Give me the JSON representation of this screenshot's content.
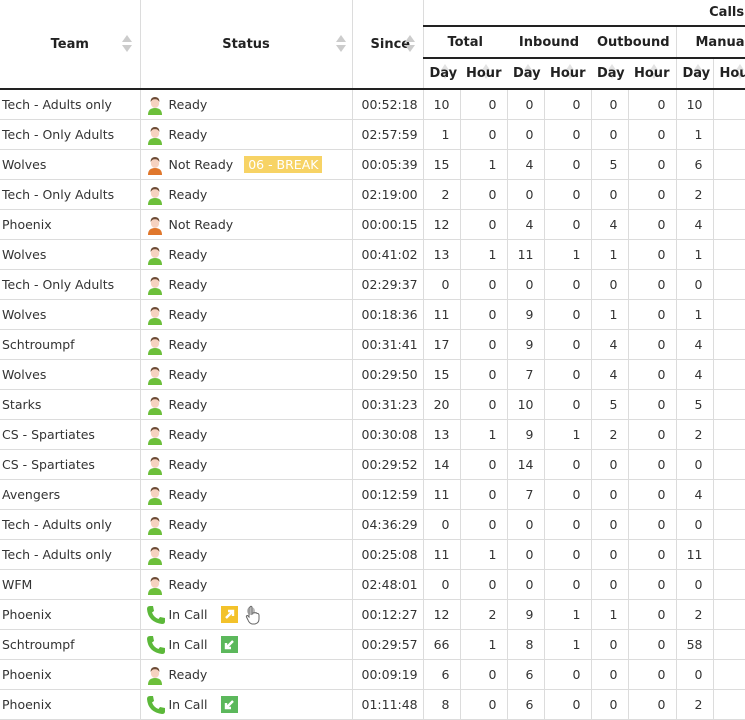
{
  "header": {
    "team": "Team",
    "status": "Status",
    "since": "Since",
    "calls": "Calls",
    "groups": [
      "Total",
      "Inbound",
      "Outbound",
      "Manual"
    ],
    "day": "Day",
    "hour": "Hour",
    "hour_truncated": "Hou"
  },
  "colors": {
    "ready_icon": "#6cbf3a",
    "not_ready_icon": "#e0772c",
    "in_call_icon": "#5cb83a",
    "break_badge": "#f7d365",
    "outbound_badge": "#f3c22b",
    "inbound_badge": "#5cb85c"
  },
  "rows": [
    {
      "team": "Tech - Adults only",
      "status": "Ready",
      "icon": "user-ready",
      "since": "00:52:18",
      "total_day": "10",
      "total_hour": "0",
      "in_day": "0",
      "in_hour": "0",
      "out_day": "0",
      "out_hour": "0",
      "man_day": "10"
    },
    {
      "team": "Tech - Only Adults",
      "status": "Ready",
      "icon": "user-ready",
      "since": "02:57:59",
      "total_day": "1",
      "total_hour": "0",
      "in_day": "0",
      "in_hour": "0",
      "out_day": "0",
      "out_hour": "0",
      "man_day": "1"
    },
    {
      "team": "Wolves",
      "status": "Not Ready",
      "icon": "user-not-ready",
      "badge": "06 - BREAK",
      "since": "00:05:39",
      "total_day": "15",
      "total_hour": "1",
      "in_day": "4",
      "in_hour": "0",
      "out_day": "5",
      "out_hour": "0",
      "man_day": "6"
    },
    {
      "team": "Tech - Only Adults",
      "status": "Ready",
      "icon": "user-ready",
      "since": "02:19:00",
      "total_day": "2",
      "total_hour": "0",
      "in_day": "0",
      "in_hour": "0",
      "out_day": "0",
      "out_hour": "0",
      "man_day": "2"
    },
    {
      "team": "Phoenix",
      "status": "Not Ready",
      "icon": "user-not-ready",
      "since": "00:00:15",
      "total_day": "12",
      "total_hour": "0",
      "in_day": "4",
      "in_hour": "0",
      "out_day": "4",
      "out_hour": "0",
      "man_day": "4"
    },
    {
      "team": "Wolves",
      "status": "Ready",
      "icon": "user-ready",
      "since": "00:41:02",
      "total_day": "13",
      "total_hour": "1",
      "in_day": "11",
      "in_hour": "1",
      "out_day": "1",
      "out_hour": "0",
      "man_day": "1"
    },
    {
      "team": "Tech - Only Adults",
      "status": "Ready",
      "icon": "user-ready",
      "since": "02:29:37",
      "total_day": "0",
      "total_hour": "0",
      "in_day": "0",
      "in_hour": "0",
      "out_day": "0",
      "out_hour": "0",
      "man_day": "0"
    },
    {
      "team": "Wolves",
      "status": "Ready",
      "icon": "user-ready",
      "since": "00:18:36",
      "total_day": "11",
      "total_hour": "0",
      "in_day": "9",
      "in_hour": "0",
      "out_day": "1",
      "out_hour": "0",
      "man_day": "1"
    },
    {
      "team": "Schtroumpf",
      "status": "Ready",
      "icon": "user-ready",
      "since": "00:31:41",
      "total_day": "17",
      "total_hour": "0",
      "in_day": "9",
      "in_hour": "0",
      "out_day": "4",
      "out_hour": "0",
      "man_day": "4"
    },
    {
      "team": "Wolves",
      "status": "Ready",
      "icon": "user-ready",
      "since": "00:29:50",
      "total_day": "15",
      "total_hour": "0",
      "in_day": "7",
      "in_hour": "0",
      "out_day": "4",
      "out_hour": "0",
      "man_day": "4"
    },
    {
      "team": "Starks",
      "status": "Ready",
      "icon": "user-ready",
      "since": "00:31:23",
      "total_day": "20",
      "total_hour": "0",
      "in_day": "10",
      "in_hour": "0",
      "out_day": "5",
      "out_hour": "0",
      "man_day": "5"
    },
    {
      "team": "CS - Spartiates",
      "status": "Ready",
      "icon": "user-ready",
      "since": "00:30:08",
      "total_day": "13",
      "total_hour": "1",
      "in_day": "9",
      "in_hour": "1",
      "out_day": "2",
      "out_hour": "0",
      "man_day": "2"
    },
    {
      "team": "CS - Spartiates",
      "status": "Ready",
      "icon": "user-ready",
      "since": "00:29:52",
      "total_day": "14",
      "total_hour": "0",
      "in_day": "14",
      "in_hour": "0",
      "out_day": "0",
      "out_hour": "0",
      "man_day": "0"
    },
    {
      "team": "Avengers",
      "status": "Ready",
      "icon": "user-ready",
      "since": "00:12:59",
      "total_day": "11",
      "total_hour": "0",
      "in_day": "7",
      "in_hour": "0",
      "out_day": "0",
      "out_hour": "0",
      "man_day": "4"
    },
    {
      "team": "Tech - Adults only",
      "status": "Ready",
      "icon": "user-ready",
      "since": "04:36:29",
      "total_day": "0",
      "total_hour": "0",
      "in_day": "0",
      "in_hour": "0",
      "out_day": "0",
      "out_hour": "0",
      "man_day": "0"
    },
    {
      "team": "Tech - Adults only",
      "status": "Ready",
      "icon": "user-ready",
      "since": "00:25:08",
      "total_day": "11",
      "total_hour": "1",
      "in_day": "0",
      "in_hour": "0",
      "out_day": "0",
      "out_hour": "0",
      "man_day": "11"
    },
    {
      "team": "WFM",
      "status": "Ready",
      "icon": "user-ready",
      "since": "02:48:01",
      "total_day": "0",
      "total_hour": "0",
      "in_day": "0",
      "in_hour": "0",
      "out_day": "0",
      "out_hour": "0",
      "man_day": "0"
    },
    {
      "team": "Phoenix",
      "status": "In Call",
      "icon": "phone",
      "direction": "outbound",
      "hand": true,
      "since": "00:12:27",
      "total_day": "12",
      "total_hour": "2",
      "in_day": "9",
      "in_hour": "1",
      "out_day": "1",
      "out_hour": "0",
      "man_day": "2"
    },
    {
      "team": "Schtroumpf",
      "status": "In Call",
      "icon": "phone",
      "direction": "inbound",
      "since": "00:29:57",
      "total_day": "66",
      "total_hour": "1",
      "in_day": "8",
      "in_hour": "1",
      "out_day": "0",
      "out_hour": "0",
      "man_day": "58"
    },
    {
      "team": "Phoenix",
      "status": "Ready",
      "icon": "user-ready",
      "since": "00:09:19",
      "total_day": "6",
      "total_hour": "0",
      "in_day": "6",
      "in_hour": "0",
      "out_day": "0",
      "out_hour": "0",
      "man_day": "0"
    },
    {
      "team": "Phoenix",
      "status": "In Call",
      "icon": "phone",
      "direction": "inbound",
      "since": "01:11:48",
      "total_day": "8",
      "total_hour": "0",
      "in_day": "6",
      "in_hour": "0",
      "out_day": "0",
      "out_hour": "0",
      "man_day": "2"
    }
  ]
}
